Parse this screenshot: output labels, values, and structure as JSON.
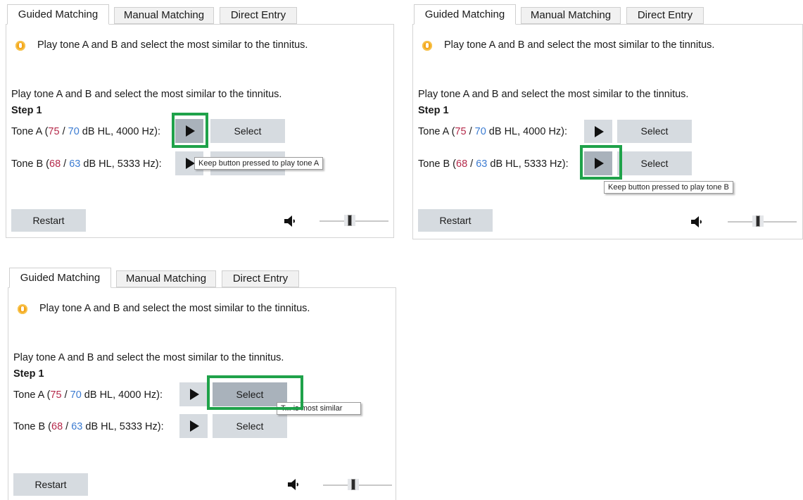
{
  "tabs": [
    "Guided Matching",
    "Manual Matching",
    "Direct Entry"
  ],
  "hint": "Play tone A and B and select the most similar to the tinnitus.",
  "instruction": "Play tone A and B and select the most similar to the tinnitus.",
  "step_label": "Step 1",
  "tone_a": {
    "prefix": "Tone A (",
    "left_db": "75",
    "sep": " / ",
    "right_db": "70",
    "suffix": " dB HL, 4000 Hz):"
  },
  "tone_b": {
    "prefix": "Tone B (",
    "left_db": "68",
    "sep": " / ",
    "right_db": "63",
    "suffix": " dB HL, 5333 Hz):"
  },
  "select_label": "Select",
  "restart_label": "Restart",
  "panels": [
    {
      "tooltip": "Keep button pressed to play tone A",
      "highlight": "play-a"
    },
    {
      "tooltip": "Keep button pressed to play tone B",
      "highlight": "play-b"
    },
    {
      "tooltip": "Tone A is most similar",
      "tooltip_visible": "T... is most similar",
      "highlight": "select-a"
    }
  ],
  "colors": {
    "left_ear": "#b5294a",
    "right_ear": "#3b7bd1",
    "highlight": "#1fa24a"
  },
  "icons": [
    "hint-icon",
    "play-icon",
    "speaker-icon",
    "volume-slider"
  ]
}
